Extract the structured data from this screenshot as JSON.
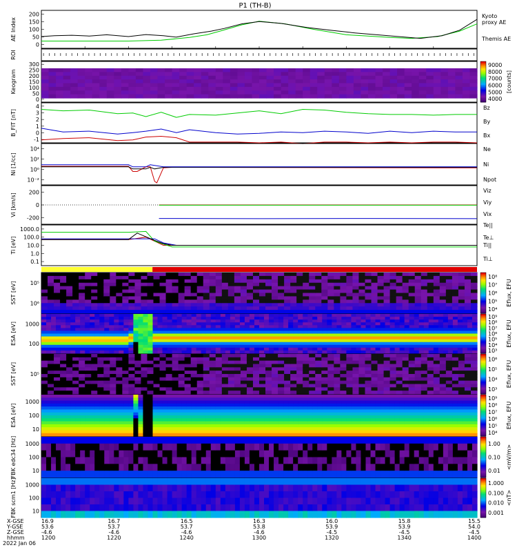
{
  "chart_data": [
    {
      "type": "line",
      "title": "P1 (TH-B)",
      "ylabel": "AE Index",
      "ylim": [
        -10,
        200
      ],
      "ytick_labels": [
        "200",
        "150",
        "100",
        "50",
        "0"
      ],
      "xlim": [
        1200,
        1400
      ],
      "series": [
        {
          "name": "Kyoto proxy AE",
          "color": "#00cc00",
          "x": [
            1200,
            1212,
            1222,
            1240,
            1255,
            1268,
            1276,
            1282,
            1292,
            1300,
            1312,
            1325,
            1340,
            1350,
            1360,
            1370,
            1382,
            1392,
            1400
          ],
          "y": [
            30,
            30,
            30,
            30,
            35,
            50,
            65,
            85,
            120,
            140,
            125,
            95,
            65,
            58,
            50,
            45,
            55,
            85,
            125
          ]
        },
        {
          "name": "Themis AE",
          "color": "#000000",
          "x": [
            1200,
            1206,
            1214,
            1222,
            1230,
            1240,
            1248,
            1256,
            1262,
            1270,
            1278,
            1284,
            1292,
            1300,
            1310,
            1322,
            1334,
            1344,
            1354,
            1364,
            1374,
            1384,
            1392,
            1400
          ],
          "y": [
            55,
            60,
            62,
            58,
            65,
            55,
            66,
            60,
            52,
            70,
            85,
            100,
            125,
            138,
            128,
            105,
            88,
            75,
            65,
            55,
            45,
            60,
            90,
            150
          ]
        }
      ],
      "legend": [
        "Kyoto proxy AE",
        "Themis AE"
      ]
    },
    {
      "type": "line",
      "ylabel": "ROI",
      "ylim": [
        0,
        1
      ]
    },
    {
      "type": "heatmap",
      "ylabel": "Keogram",
      "ylim": [
        0,
        300
      ],
      "ytick_labels": [
        "300",
        "250",
        "200",
        "150",
        "100",
        "50",
        "0"
      ],
      "colorbar": {
        "label": "[counts]",
        "ticks": [
          "9000",
          "8000",
          "7000",
          "6000",
          "5000",
          "4000"
        ]
      }
    },
    {
      "type": "line",
      "ylabel": "B_FIT [nT]",
      "ylim": [
        -1,
        4.5
      ],
      "ytick_labels": [
        "4",
        "3",
        "2",
        "1",
        "0",
        "-1"
      ],
      "legend": [
        "Bz",
        "By",
        "Bx"
      ],
      "series": [
        {
          "name": "Bz",
          "color": "#00cc00",
          "x": [
            1200,
            1210,
            1222,
            1235,
            1242,
            1248,
            1255,
            1262,
            1268,
            1280,
            1290,
            1300,
            1310,
            1320,
            1330,
            1340,
            1350,
            1360,
            1370,
            1380,
            1390,
            1400
          ],
          "y": [
            3.6,
            3.4,
            3.5,
            3.0,
            3.1,
            2.6,
            3.2,
            2.5,
            2.9,
            2.8,
            3.1,
            3.4,
            3.0,
            3.6,
            3.5,
            3.2,
            3.0,
            2.9,
            2.9,
            2.8,
            2.9,
            2.9
          ]
        },
        {
          "name": "By",
          "color": "#0000cc",
          "x": [
            1200,
            1210,
            1222,
            1235,
            1242,
            1248,
            1255,
            1262,
            1268,
            1280,
            1290,
            1300,
            1310,
            1320,
            1330,
            1340,
            1350,
            1360,
            1370,
            1380,
            1390,
            1400
          ],
          "y": [
            1.0,
            0.5,
            0.6,
            0.2,
            0.4,
            0.6,
            0.9,
            0.4,
            0.8,
            0.4,
            0.2,
            0.3,
            0.5,
            0.4,
            0.6,
            0.5,
            0.3,
            0.6,
            0.4,
            0.6,
            0.5,
            0.5
          ]
        },
        {
          "name": "Bx",
          "color": "#cc0000",
          "x": [
            1200,
            1210,
            1222,
            1235,
            1242,
            1248,
            1255,
            1262,
            1268,
            1280,
            1290,
            1300,
            1310,
            1320,
            1330,
            1340,
            1350,
            1360,
            1370,
            1380,
            1390,
            1400
          ],
          "y": [
            -0.6,
            -0.4,
            -0.3,
            -0.7,
            -0.6,
            -0.2,
            -0.1,
            -0.3,
            -0.9,
            -0.9,
            -0.9,
            -1.0,
            -0.9,
            -1.1,
            -0.9,
            -0.9,
            -1.0,
            -0.9,
            -1.0,
            -0.9,
            -0.9,
            -1.0
          ]
        }
      ]
    },
    {
      "type": "line",
      "ylabel": "Ni [1/cc]",
      "ytick_labels": [
        "10⁴",
        "10²",
        "10⁰",
        "10⁻²"
      ],
      "legend": [
        "Ne",
        "Ni",
        "Npot"
      ],
      "series": [
        {
          "name": "Ne",
          "color": "#cc0000",
          "x": [
            1200,
            1240,
            1242,
            1244,
            1248,
            1250,
            1252,
            1253,
            1256,
            1260,
            1400
          ],
          "y": [
            0.6,
            0.6,
            -0.4,
            -0.4,
            0.5,
            0.5,
            -2.3,
            -2.6,
            0.3,
            0.4,
            0.3
          ]
        },
        {
          "name": "Ni",
          "color": "#000000",
          "x": [
            1200,
            1240,
            1242,
            1248,
            1250,
            1252,
            1256,
            1400
          ],
          "y": [
            0.5,
            0.5,
            0.1,
            0.1,
            0.4,
            0.1,
            0.4,
            0.4
          ]
        },
        {
          "name": "Npot",
          "color": "#0000cc",
          "x": [
            1200,
            1240,
            1242,
            1248,
            1250,
            1256,
            1400
          ],
          "y": [
            0.9,
            0.9,
            0.5,
            0.5,
            0.9,
            0.5,
            0.5
          ]
        }
      ]
    },
    {
      "type": "line",
      "ylabel": "Vi [km/s]",
      "ylim": [
        -400,
        400
      ],
      "ytick_labels": [
        "200",
        "0",
        "-200"
      ],
      "legend": [
        "Viz",
        "Viy",
        "Vix"
      ],
      "series": [
        {
          "name": "Viz",
          "color": "#cc0000",
          "x": [
            1254,
            1400
          ],
          "y": [
            0,
            0
          ]
        },
        {
          "name": "Viy",
          "color": "#00cc00",
          "x": [
            1254,
            1400
          ],
          "y": [
            -5,
            -5
          ]
        },
        {
          "name": "Vix",
          "color": "#0000cc",
          "x": [
            1254,
            1300,
            1350,
            1400
          ],
          "y": [
            -280,
            -285,
            -280,
            -285
          ]
        }
      ]
    },
    {
      "type": "line",
      "ylabel": "Ti [eV]",
      "ytick_labels": [
        "1000.0",
        "100.0",
        "10.0",
        "1.0",
        "0.1"
      ],
      "legend": [
        "Te||",
        "Te⊥",
        "Ti||",
        "Ti⊥"
      ],
      "series": [
        {
          "name": "Te⊥",
          "color": "#cc0000",
          "x": [
            1200,
            1240,
            1248,
            1256,
            1262,
            1400
          ],
          "y": [
            1.7,
            1.7,
            2.0,
            1.0,
            1.0,
            1.0
          ]
        },
        {
          "name": "Ti||",
          "color": "#00cc00",
          "x": [
            1200,
            1240,
            1248,
            1252,
            1260,
            1400
          ],
          "y": [
            2.6,
            2.6,
            2.7,
            1.5,
            0.8,
            0.8
          ]
        },
        {
          "name": "Ti⊥",
          "color": "#0000cc",
          "x": [
            1200,
            1240,
            1252,
            1256,
            1262,
            1400
          ],
          "y": [
            1.8,
            1.8,
            1.8,
            1.3,
            1.0,
            1.0
          ]
        },
        {
          "name": "Te||",
          "color": "#000000",
          "x": [
            1200,
            1240,
            1244,
            1252,
            1256,
            1260,
            1400
          ],
          "y": [
            1.7,
            1.7,
            2.5,
            1.6,
            1.2,
            1.0,
            1.0
          ]
        }
      ]
    },
    {
      "type": "heatmap",
      "ylabel": "SST [eV]",
      "ytick_labels": [
        "10⁵",
        "10⁶"
      ],
      "colorbar": {
        "label": "Eflux, EFU",
        "ticks": [
          "10⁸",
          "10⁷",
          "10⁶",
          "10⁵",
          "10⁴"
        ]
      }
    },
    {
      "type": "heatmap",
      "ylabel": "ESA [eV]",
      "ytick_labels": [
        "1000",
        "100"
      ],
      "colorbar": {
        "label": "Eflux, EFU",
        "ticks": [
          "10⁹",
          "10⁸",
          "10⁷",
          "10⁶",
          "10⁵",
          "10⁴",
          "10³"
        ]
      }
    },
    {
      "type": "heatmap",
      "ylabel": "SST [eV]",
      "ytick_labels": [
        "10⁵"
      ],
      "colorbar": {
        "label": "Eflux, EFU",
        "ticks": [
          "10⁶",
          "10⁵",
          "10⁴",
          "10³"
        ]
      }
    },
    {
      "type": "heatmap",
      "ylabel": "ESA [eV]",
      "ytick_labels": [
        "1000",
        "100",
        "10"
      ],
      "colorbar": {
        "label": "Eflux, EFU",
        "ticks": [
          "10⁹",
          "10⁸",
          "10⁷",
          "10⁶",
          "10⁵",
          "10⁴"
        ]
      }
    },
    {
      "type": "heatmap",
      "ylabel": "FBK edc34 [Hz]",
      "ytick_labels": [
        "1000",
        "100",
        "10"
      ],
      "colorbar": {
        "label": "<mV/m>",
        "ticks": [
          "1.00",
          "0.10",
          "0.01"
        ]
      }
    },
    {
      "type": "heatmap",
      "ylabel": "FBK scm1 [Hz]",
      "ytick_labels": [
        "1000",
        "100",
        "10"
      ],
      "colorbar": {
        "label": "<nT>",
        "ticks": [
          "1.000",
          "0.100",
          "0.010",
          "0.001"
        ]
      }
    }
  ],
  "figure": {
    "title": "P1 (TH-B)",
    "right_labels": {
      "ae": [
        "Kyoto",
        "proxy AE",
        "Themis AE"
      ],
      "b": [
        "Bz",
        "By",
        "Bx"
      ],
      "n": [
        "Ne",
        "Ni",
        "Npot"
      ],
      "v": [
        "Viz",
        "Viy",
        "Vix"
      ],
      "t": [
        "Te||",
        "Te⊥",
        "Ti||",
        "Ti⊥"
      ]
    },
    "ephemeris": {
      "row_labels": [
        "X-GSE",
        "Y-GSE",
        "Z-GSE",
        "hhmm",
        "2022 Jan 06"
      ],
      "columns": [
        [
          "16.9",
          "53.6",
          "-4.6",
          "1200"
        ],
        [
          "16.7",
          "53.7",
          "-4.6",
          "1220"
        ],
        [
          "16.5",
          "53.7",
          "-4.6",
          "1240"
        ],
        [
          "16.3",
          "53.8",
          "-4.6",
          "1300"
        ],
        [
          "16.0",
          "53.9",
          "-4.5",
          "1320"
        ],
        [
          "15.8",
          "53.9",
          "-4.5",
          "1340"
        ],
        [
          "15.5",
          "54.0",
          "-4.5",
          "1400"
        ]
      ]
    },
    "colors": {
      "kyoto": "#00cc00",
      "themis": "#000000",
      "mode_slow": "#ffff33",
      "mode_fast": "#e00000"
    }
  }
}
